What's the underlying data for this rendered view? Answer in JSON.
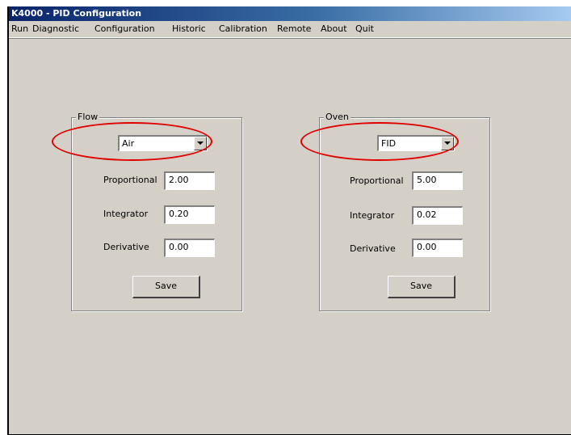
{
  "window": {
    "title": "K4000 - PID Configuration"
  },
  "menu": [
    "Run",
    "Diagnostic",
    "Configuration",
    "Historic",
    "Calibration",
    "Remote",
    "About",
    "Quit"
  ],
  "flow": {
    "legend": "Flow",
    "selected": "Air",
    "proportional_label": "Proportional",
    "proportional_value": "2.00",
    "integrator_label": "Integrator",
    "integrator_value": "0.20",
    "derivative_label": "Derivative",
    "derivative_value": "0.00",
    "save_label": "Save"
  },
  "oven": {
    "legend": "Oven",
    "selected": "FID",
    "proportional_label": "Proportional",
    "proportional_value": "5.00",
    "integrator_label": "Integrator",
    "integrator_value": "0.02",
    "derivative_label": "Derivative",
    "derivative_value": "0.00",
    "save_label": "Save"
  },
  "colors": {
    "title_bar": "#0a246a",
    "window_bg": "#d4d0c8",
    "annotation": "#e00000"
  }
}
